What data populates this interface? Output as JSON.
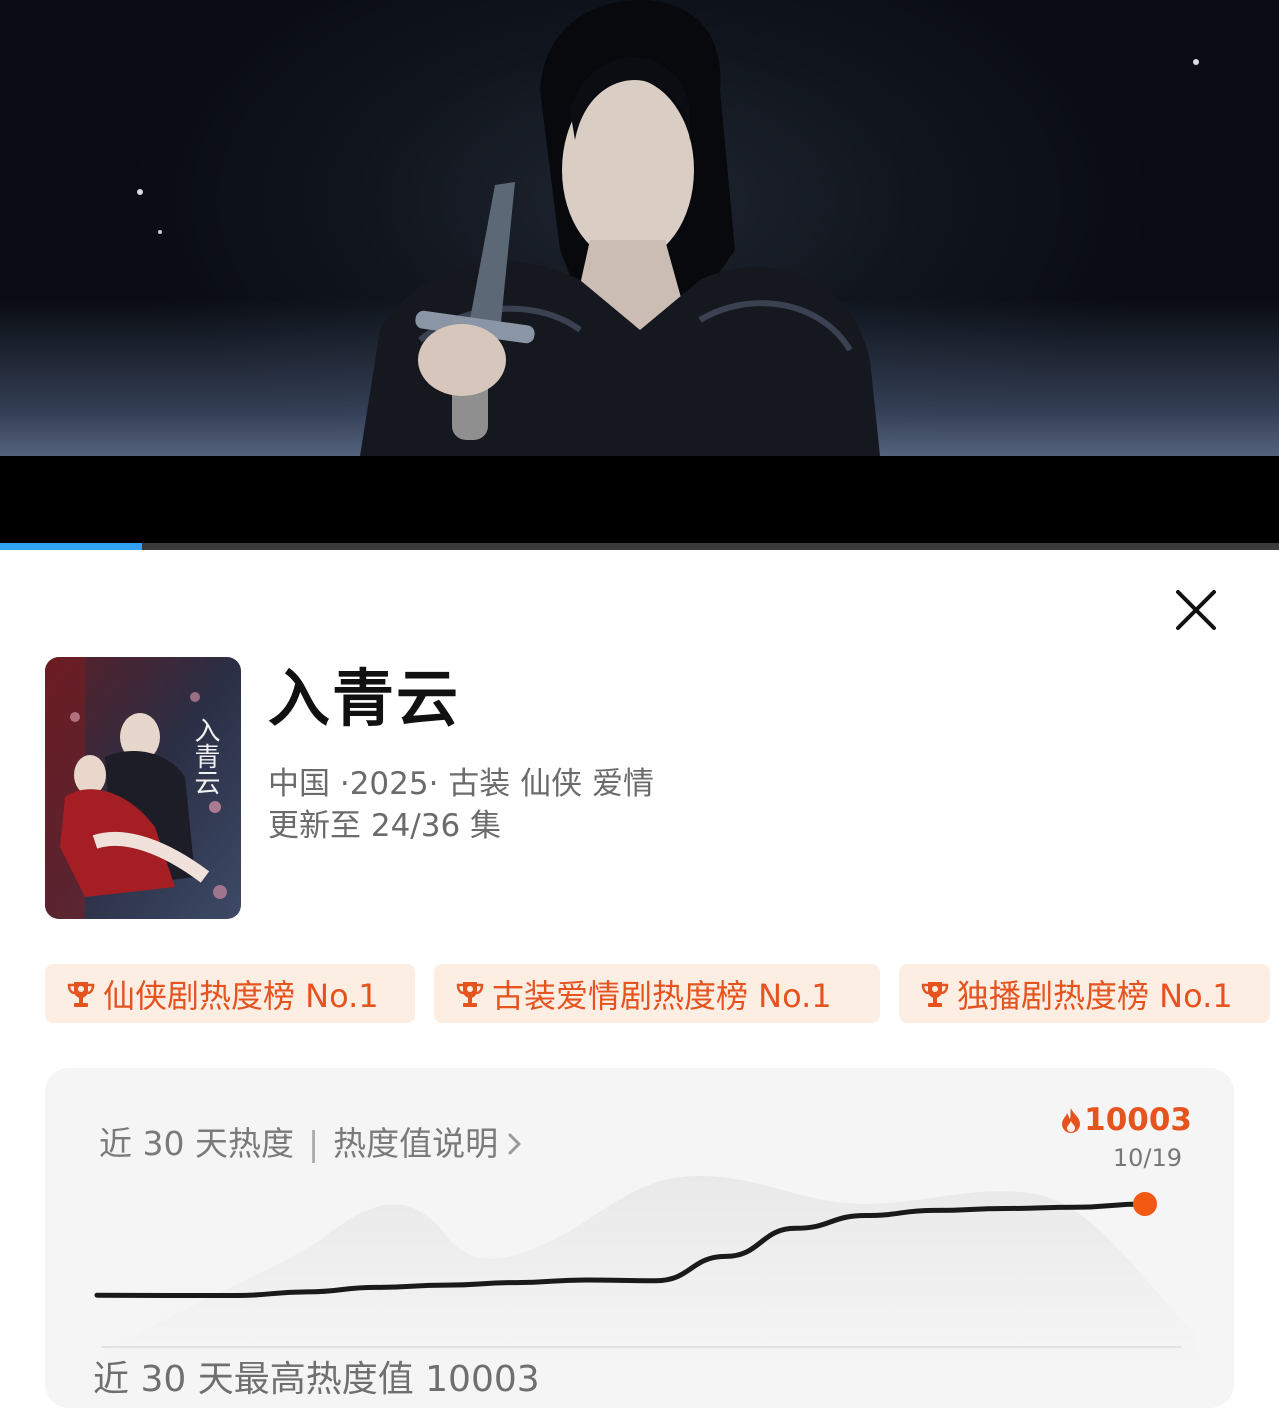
{
  "player": {
    "progress": 0.111,
    "progress_color": "#2fa3f2"
  },
  "detail": {
    "title": "入青云",
    "meta": "中国 ·2025· 古装 仙侠 爱情",
    "update": "更新至 24/36 集",
    "poster_title": "入青云",
    "close_icon": "close-icon"
  },
  "badges": [
    {
      "label": "仙侠剧热度榜 No.1",
      "icon": "trophy-icon"
    },
    {
      "label": "古装爱情剧热度榜 No.1",
      "icon": "trophy-icon"
    },
    {
      "label": "独播剧热度榜 No.1",
      "icon": "trophy-icon"
    }
  ],
  "heat": {
    "title": "近 30 天热度",
    "separator": "|",
    "explain_label": "热度值说明",
    "current_value": "10003",
    "current_date": "10/19",
    "footer_text": "近 30 天最高热度值 10003",
    "accent_color": "#f25a14"
  },
  "chart_data": {
    "type": "line",
    "title": "近 30 天热度",
    "series": [
      {
        "values": [
          2860,
          2840,
          2840,
          3120,
          3470,
          3650,
          3850,
          4050,
          4000,
          5900,
          8100,
          9100,
          9500,
          9650,
          9750,
          10003
        ]
      }
    ],
    "highlight": {
      "label": "10/19",
      "value": 10003
    },
    "grid": false,
    "legend": "none"
  }
}
